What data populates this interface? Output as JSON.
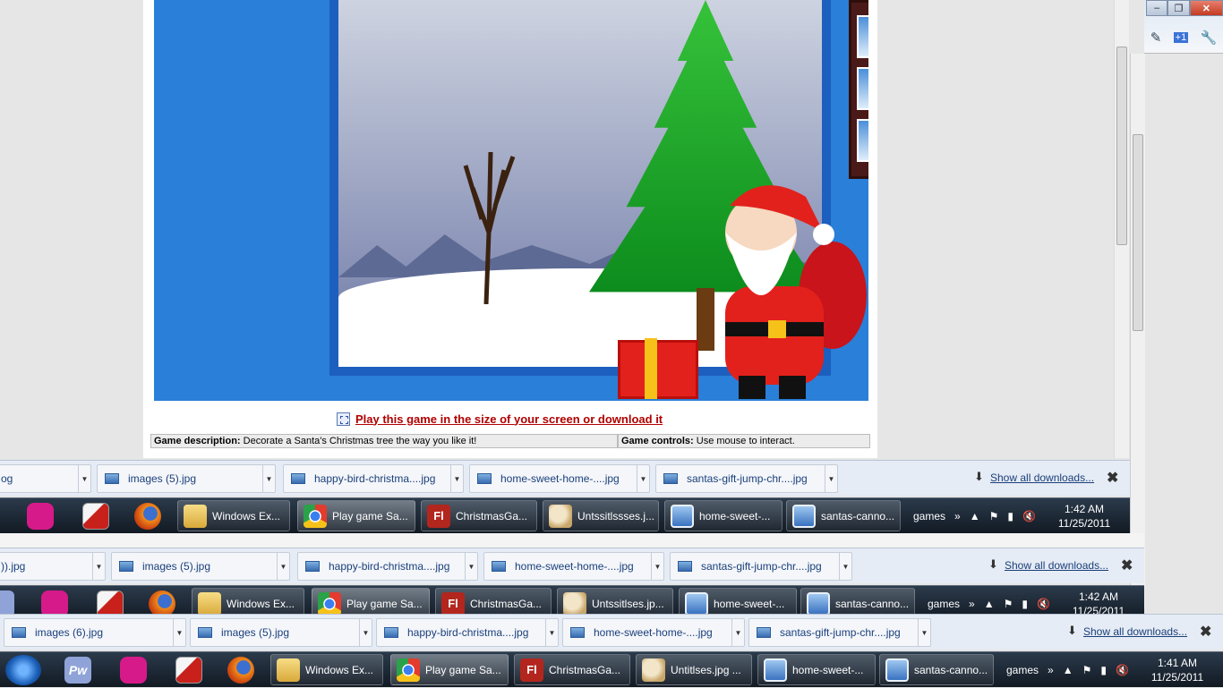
{
  "game": {
    "play_link": "Play this game in the size of your screen or download it",
    "desc_label": "Game description:",
    "desc_text": "Decorate a Santa's Christmas tree the way you like it!",
    "controls_label": "Game controls:",
    "controls_text": "Use mouse to interact."
  },
  "window_buttons": {
    "minimize": "–",
    "restore": "❐",
    "close": "✕"
  },
  "downloads_1": {
    "items": [
      "og",
      "images (5).jpg",
      "happy-bird-christma....jpg",
      "home-sweet-home-....jpg",
      "santas-gift-jump-chr....jpg"
    ],
    "show_all": "Show all downloads...",
    "close": "✖"
  },
  "downloads_2": {
    "items": [
      ")).jpg",
      "images (5).jpg",
      "happy-bird-christma....jpg",
      "home-sweet-home-....jpg",
      "santas-gift-jump-chr....jpg"
    ],
    "show_all": "Show all downloads...",
    "close": "✖"
  },
  "downloads_3": {
    "items": [
      "images (6).jpg",
      "images (5).jpg",
      "happy-bird-christma....jpg",
      "home-sweet-home-....jpg",
      "santas-gift-jump-chr....jpg"
    ],
    "show_all": "Show all downloads...",
    "close": "✖"
  },
  "taskbar_1": {
    "buttons": [
      "Windows Ex...",
      "Play game Sa...",
      "ChristmasGa...",
      "Untssitlssses.j...",
      "home-sweet-...",
      "santas-canno..."
    ],
    "flash_glyph": "Fl",
    "toolbar": "games",
    "time": "1:42 AM",
    "date": "11/25/2011"
  },
  "taskbar_2": {
    "buttons": [
      "Windows Ex...",
      "Play game Sa...",
      "ChristmasGa...",
      "Untssitlses.jp...",
      "home-sweet-...",
      "santas-canno..."
    ],
    "flash_glyph": "Fl",
    "toolbar": "games",
    "time": "1:42 AM",
    "date": "11/25/2011"
  },
  "taskbar_3": {
    "buttons": [
      "Windows Ex...",
      "Play game Sa...",
      "ChristmasGa...",
      "Untitlses.jpg ...",
      "home-sweet-...",
      "santas-canno..."
    ],
    "flash_glyph": "Fl",
    "pw_glyph": "Pw",
    "toolbar": "games",
    "time": "1:41 AM",
    "date": "11/25/2011"
  },
  "icons": {
    "chrome": "chrome-icon",
    "flash": "flash-icon",
    "paint": "paint-icon",
    "image": "image-viewer-icon",
    "folder": "folder-icon",
    "firefox": "firefox-icon",
    "start": "windows-start-icon"
  }
}
